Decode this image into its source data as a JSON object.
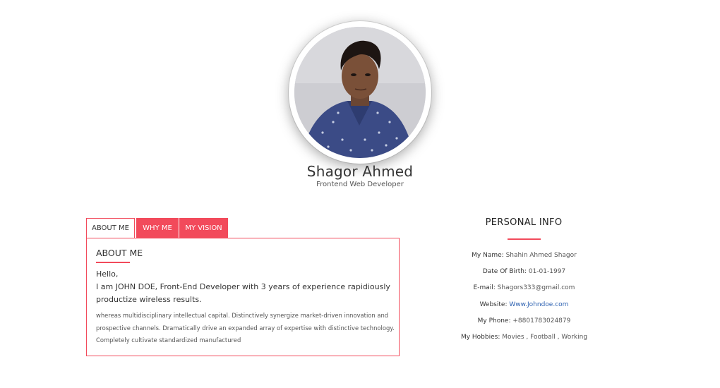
{
  "profile": {
    "name": "Shagor Ahmed",
    "role": "Frontend Web Developer"
  },
  "tabs": [
    {
      "label": "ABOUT ME",
      "active": true
    },
    {
      "label": "WHY ME",
      "active": false
    },
    {
      "label": "MY VISION",
      "active": false
    }
  ],
  "about": {
    "title": "ABOUT ME",
    "greeting_line1": "Hello,",
    "greeting_line2": "I am JOHN DOE, Front-End Developer with 3 years of experience rapidiously productize wireless results.",
    "description": "whereas multidisciplinary intellectual capital. Distinctively synergize market-driven innovation and prospective channels. Dramatically drive an expanded array of expertise with distinctive technology. Completely cultivate standardized manufactured"
  },
  "personal_info": {
    "title": "PERSONAL INFO",
    "rows": [
      {
        "label": "My Name:",
        "value": "Shahin Ahmed Shagor"
      },
      {
        "label": "Date Of Birth:",
        "value": "01-01-1997"
      },
      {
        "label": "E-mail:",
        "value": "Shagors333@gmail.com"
      },
      {
        "label": "Website:",
        "value": "Www.Johndoe.com"
      },
      {
        "label": "My Phone:",
        "value": "+8801783024879"
      },
      {
        "label": "My Hobbies:",
        "value": "Movies , Football , Working"
      }
    ]
  },
  "colors": {
    "accent": "#f24a5b",
    "link": "#2a5fb0"
  }
}
